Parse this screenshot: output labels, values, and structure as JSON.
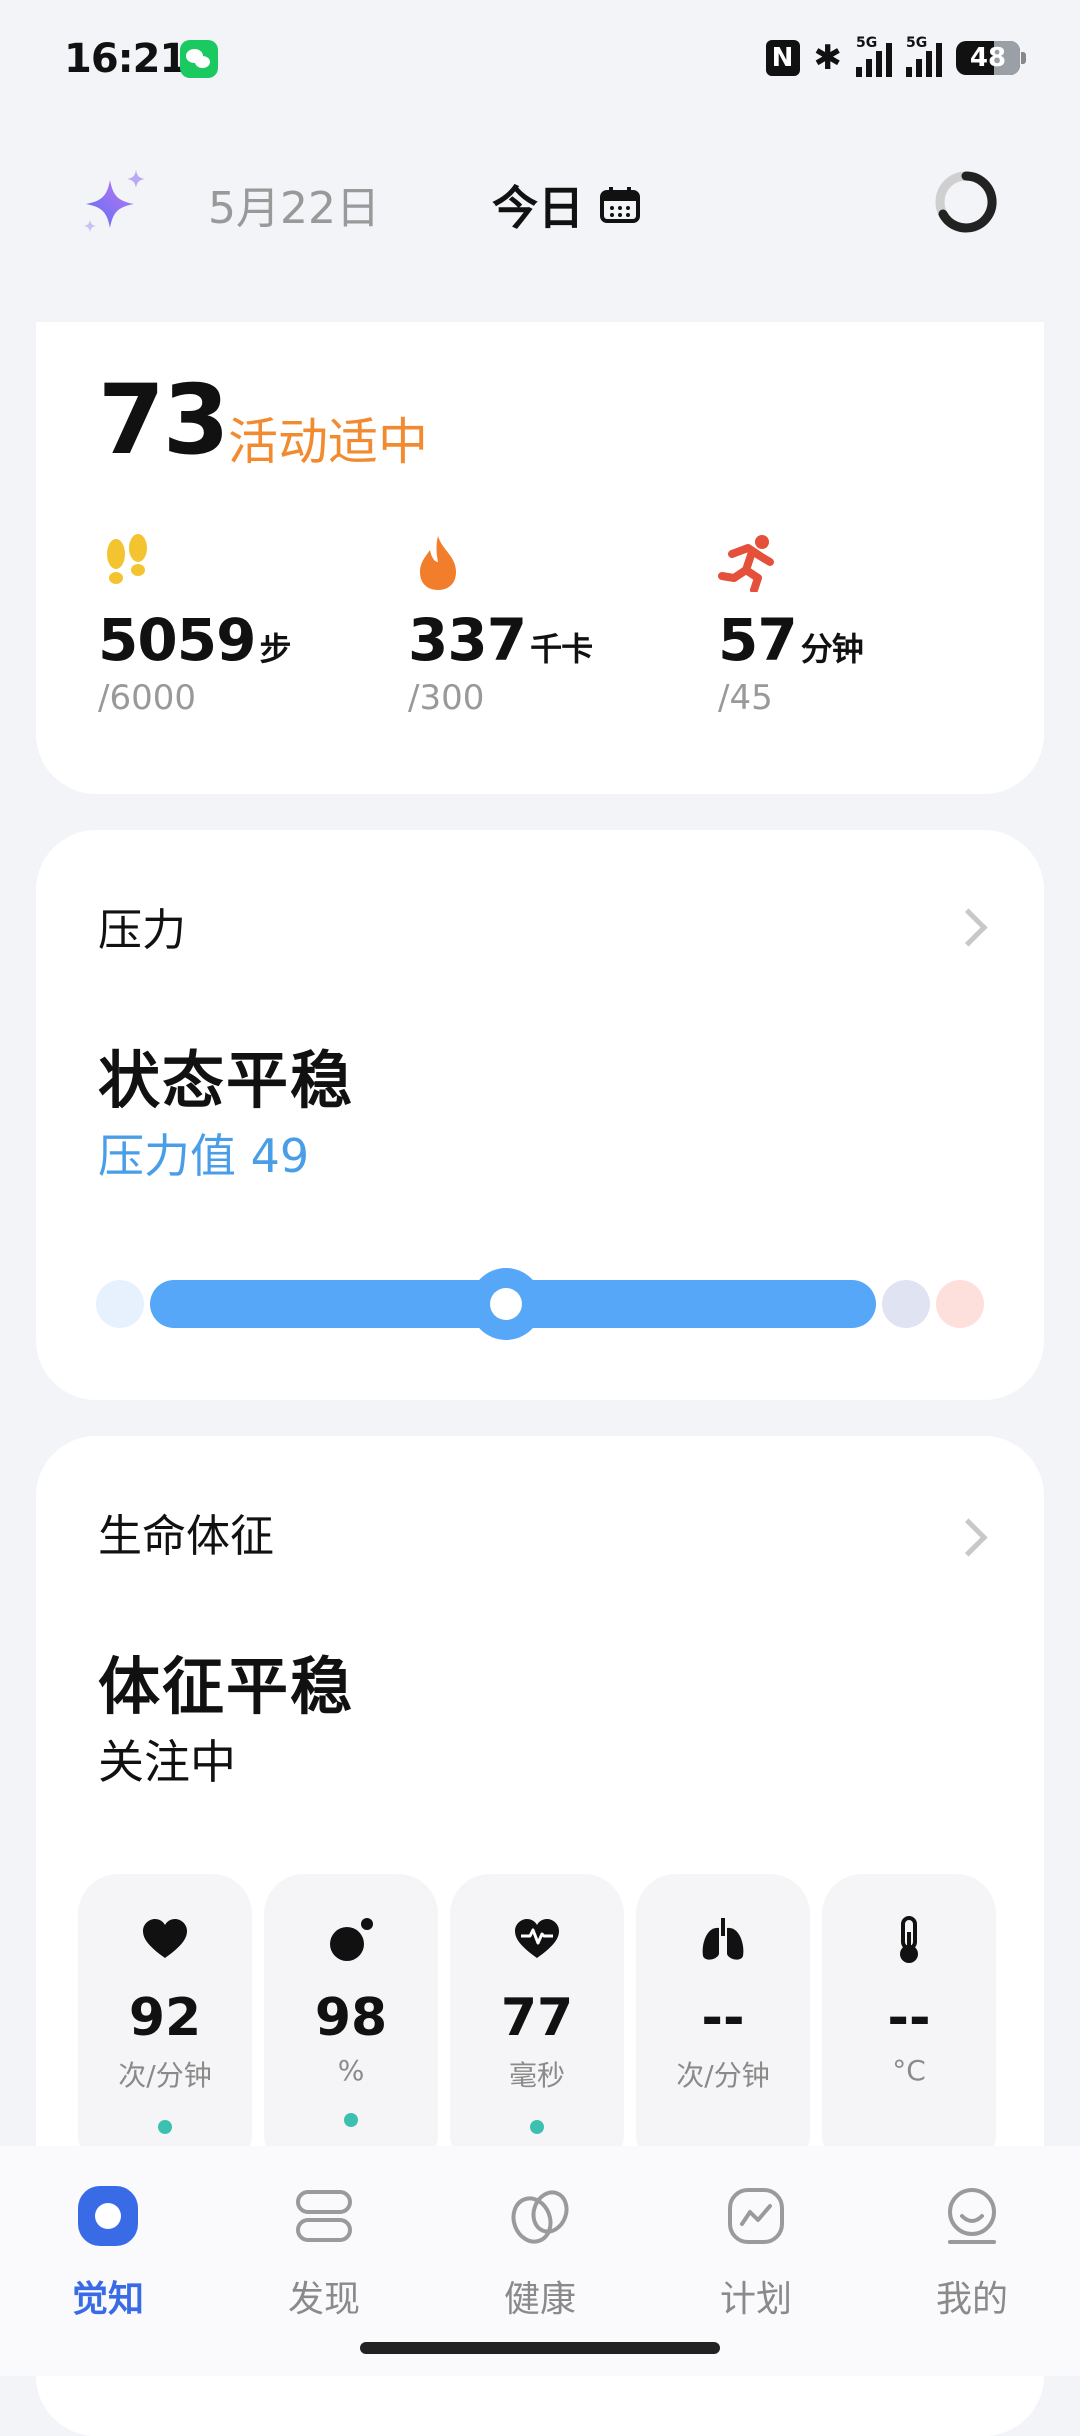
{
  "status_bar": {
    "time": "16:21",
    "nfc": "N",
    "battery": "48"
  },
  "header": {
    "date": "5月22日",
    "today": "今日"
  },
  "activity": {
    "score": "73",
    "status": "活动适中",
    "metrics": [
      {
        "icon": "footprints-icon",
        "value": "5059",
        "unit": "步",
        "goal": "/6000"
      },
      {
        "icon": "flame-icon",
        "value": "337",
        "unit": "千卡",
        "goal": "/300"
      },
      {
        "icon": "running-icon",
        "value": "57",
        "unit": "分钟",
        "goal": "/45"
      }
    ]
  },
  "stress": {
    "title": "压力",
    "state": "状态平稳",
    "value_text": "压力值 49",
    "level": 0.49
  },
  "vitals": {
    "title": "生命体征",
    "state": "体征平稳",
    "sub": "关注中",
    "tiles": [
      {
        "icon": "heart-icon",
        "value": "92",
        "unit": "次/分钟"
      },
      {
        "icon": "blood-oxygen-icon",
        "value": "98",
        "unit": "%"
      },
      {
        "icon": "hrv-icon",
        "value": "77",
        "unit": "毫秒"
      },
      {
        "icon": "lungs-icon",
        "value": "--",
        "unit": "次/分钟"
      },
      {
        "icon": "thermometer-icon",
        "value": "--",
        "unit": "°C"
      }
    ]
  },
  "nav": {
    "items": [
      "觉知",
      "发现",
      "健康",
      "计划",
      "我的"
    ]
  },
  "colors": {
    "accent": "#3a6be6",
    "stress_blue": "#56a7f7",
    "activity_orange": "#f28b30",
    "vital_dot": "#3cc0b0"
  }
}
